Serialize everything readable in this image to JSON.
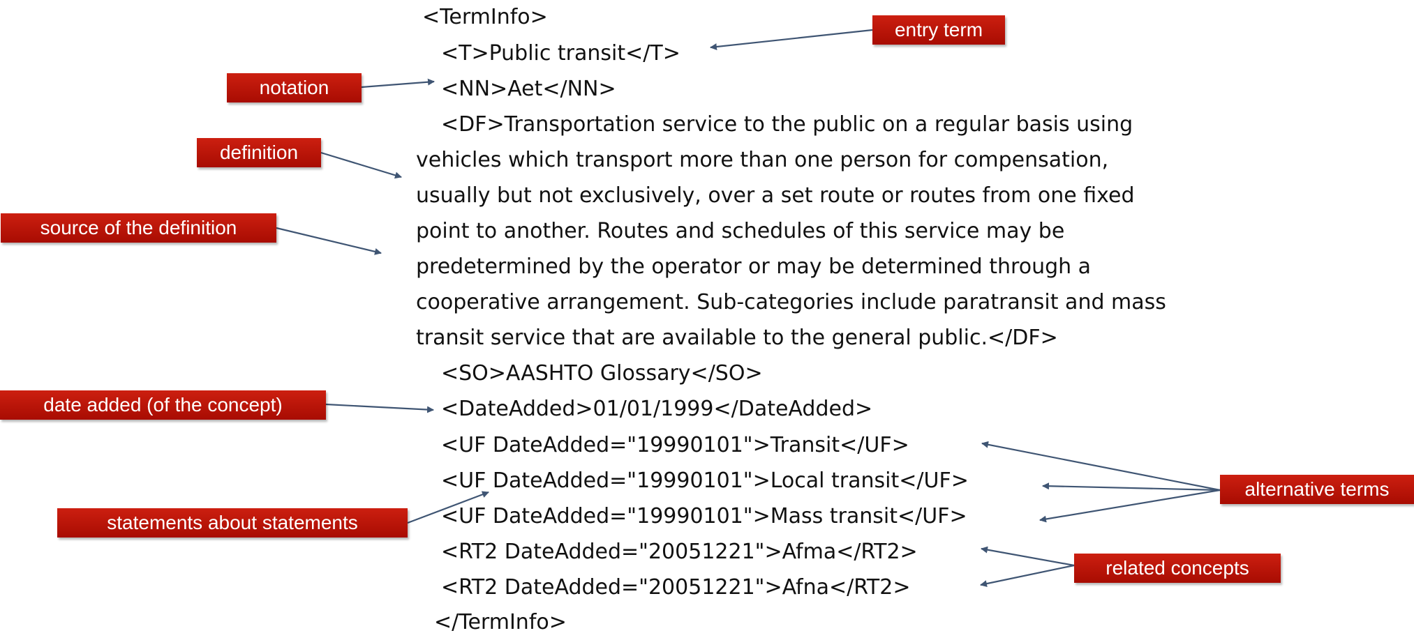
{
  "xml_lines": [
    "<TermInfo>",
    "<T>Public transit</T>",
    "<NN>Aet</NN>",
    "<DF>Transportation service to the public on a regular basis using",
    "vehicles which transport more than one person for compensation,",
    "usually but not exclusively, over a set route or routes from one fixed",
    "point to another. Routes and schedules of this service may be",
    "predetermined by the operator or may be determined through a",
    "cooperative arrangement. Sub-categories include paratransit and mass",
    "transit service that are available to the general public.</DF>",
    "<SO>AASHTO Glossary</SO>",
    "<DateAdded>01/01/1999</DateAdded>",
    "<UF DateAdded=\"19990101\">Transit</UF>",
    "<UF DateAdded=\"19990101\">Local transit</UF>",
    "<UF DateAdded=\"19990101\">Mass transit</UF>",
    "<RT2 DateAdded=\"20051221\">Afma</RT2>",
    "<RT2 DateAdded=\"20051221\">Afna</RT2>",
    "</TermInfo>"
  ],
  "labels": {
    "entry_term": "entry term",
    "notation": "notation",
    "definition": "definition",
    "source_of_definition": "source of the definition",
    "date_added": "date added (of the concept)",
    "statements_about_statements": "statements about statements",
    "alternative_terms": "alternative terms",
    "related_concepts": "related concepts"
  },
  "colors": {
    "label_background": "#b5150a",
    "label_text": "#ffffff",
    "arrow": "#3f5573",
    "text": "#111111"
  }
}
